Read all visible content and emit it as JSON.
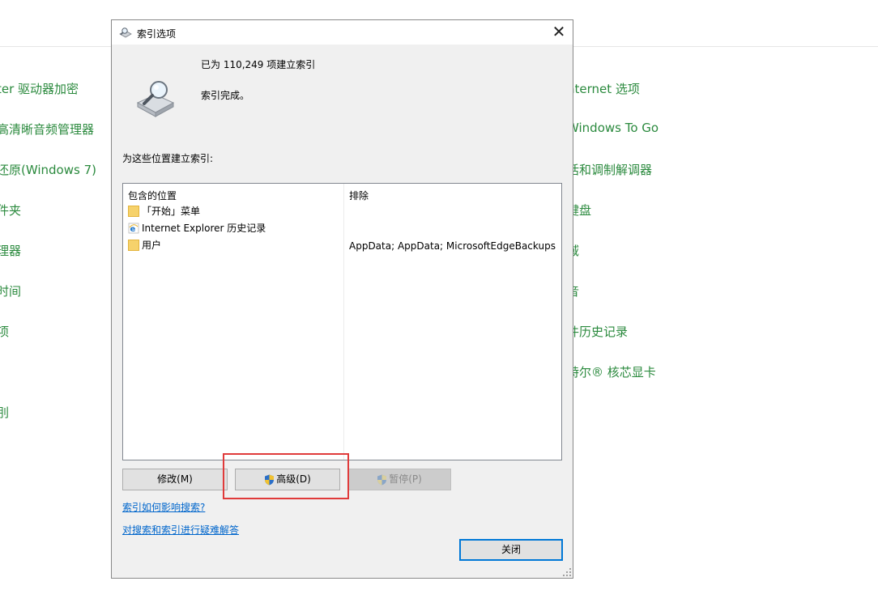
{
  "background": {
    "left_links": [
      "ter 驱动器加密",
      "高清晰音频管理器",
      "还原(Windows 7)",
      "件夹",
      "理器",
      "时间",
      "项",
      "",
      "刖"
    ],
    "right_links": [
      "nternet 选项",
      "Windows To Go",
      "话和调制解调器",
      "键盘",
      "域",
      "音",
      "件历史记录",
      "特尔® 核芯显卡"
    ],
    "link_color": "#2b8a3e"
  },
  "dialog": {
    "title": "索引选项",
    "close_glyph": "✕",
    "status_count": "已为 110,249 项建立索引",
    "status_state": "索引完成。",
    "section_label": "为这些位置建立索引:",
    "table": {
      "headers": [
        "包含的位置",
        "排除"
      ],
      "rows": [
        {
          "location": "「开始」菜单",
          "icon": "folder-icon",
          "exclude": ""
        },
        {
          "location": "Internet Explorer 历史记录",
          "icon": "ie-icon",
          "exclude": ""
        },
        {
          "location": "用户",
          "icon": "folder-icon",
          "exclude": "AppData; AppData; MicrosoftEdgeBackups"
        }
      ]
    },
    "buttons": {
      "modify": "修改(M)",
      "advanced": "高级(D)",
      "pause": "暂停(P)",
      "close": "关闭"
    },
    "links": {
      "how_indexing": "索引如何影响搜索?",
      "troubleshoot": "对搜索和索引进行疑难解答"
    },
    "highlight_color": "#e03b3b"
  }
}
